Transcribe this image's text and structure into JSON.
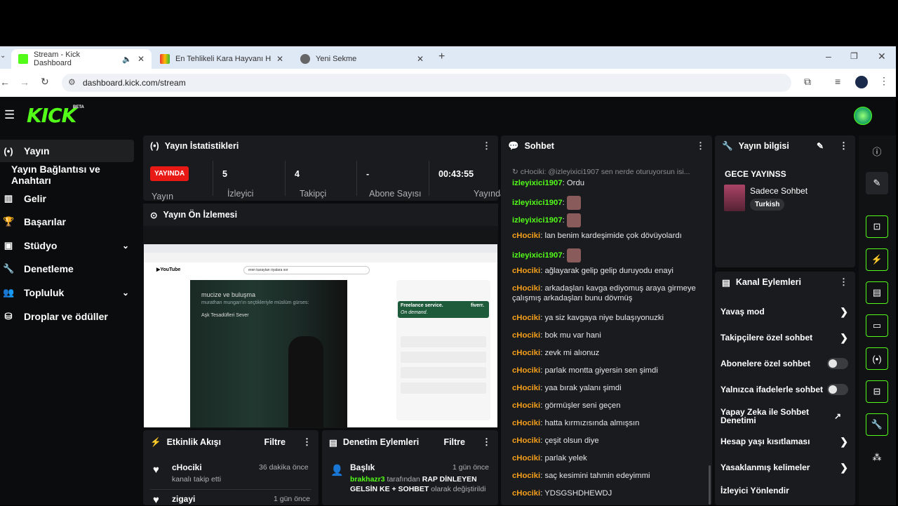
{
  "browser": {
    "tabs": [
      {
        "title": "Stream - Kick Dashboard",
        "active": true
      },
      {
        "title": "En Tehlikeli Kara Hayvanı Hangi",
        "active": false
      },
      {
        "title": "Yeni Sekme",
        "active": false
      }
    ],
    "url": "dashboard.kick.com/stream"
  },
  "app": {
    "logo": "KICK",
    "logo_badge": "BETA",
    "nav": [
      {
        "label": "Yayın",
        "icon": "broadcast-icon",
        "active": true
      },
      {
        "label": "Yayın Bağlantısı ve Anahtarı",
        "icon": "",
        "active": false
      },
      {
        "label": "Gelir",
        "icon": "revenue-icon",
        "active": false
      },
      {
        "label": "Başarılar",
        "icon": "trophy-icon",
        "active": false
      },
      {
        "label": "Stüdyo",
        "icon": "studio-icon",
        "active": false,
        "expandable": true
      },
      {
        "label": "Denetleme",
        "icon": "wrench-icon",
        "active": false
      },
      {
        "label": "Topluluk",
        "icon": "community-icon",
        "active": false,
        "expandable": true
      },
      {
        "label": "Droplar ve ödüller",
        "icon": "drops-icon",
        "active": false
      }
    ]
  },
  "stats": {
    "title": "Yayın İstatistikleri",
    "live_badge": "YAYINDA",
    "items": [
      {
        "label": "Yayın",
        "value": ""
      },
      {
        "label": "İzleyici",
        "value": "5"
      },
      {
        "label": "Takipçi",
        "value": "4"
      },
      {
        "label": "Abone Sayısı",
        "value": "-"
      },
      {
        "label": "Yayında",
        "value": "00:43:55"
      }
    ]
  },
  "preview": {
    "title": "Yayın Ön İzlemesi",
    "video_title_1": "mucize ve buluşma",
    "video_title_2": "murathan mungan'ın seçtikleriyle müslüm gürses:",
    "video_title_3": "Aşk Tesadüfleri Sever",
    "search_text": "eren karaytan riyalara sor",
    "ad_title": "Freelance service.",
    "ad_sub": "On demand.",
    "ad_brand": "fiverr."
  },
  "activity": {
    "title": "Etkinlik Akışı",
    "filter": "Filtre",
    "items": [
      {
        "user": "cHociki",
        "time": "36 dakika önce",
        "text": "kanalı takip etti"
      },
      {
        "user": "zigayi",
        "time": "1 gün önce",
        "text": ""
      }
    ]
  },
  "moderation": {
    "title": "Denetim Eylemleri",
    "filter": "Filtre",
    "items": [
      {
        "heading": "Başlık",
        "time": "1 gün önce",
        "actor": "brakhazr3",
        "text1": " tarafından ",
        "value": "RAP DİNLEYEN GELSİN KE + SOHBET",
        "text2": " olarak değiştirildi"
      }
    ]
  },
  "chat": {
    "title": "Sohbet",
    "reply": "↻ cHociki: @izleyixici1907 sen nerde oturuyorsun isi...",
    "messages": [
      {
        "user": "izleyixici1907",
        "text": "Ordu",
        "emote": false,
        "color": "green"
      },
      {
        "user": "izleyixici1907",
        "text": "",
        "emote": true,
        "color": "green"
      },
      {
        "user": "izleyixici1907",
        "text": "",
        "emote": true,
        "color": "green"
      },
      {
        "user": "cHociki",
        "text": "lan benim kardeşimide çok dövüyolardı",
        "emote": false,
        "color": "orange"
      },
      {
        "user": "izleyixici1907",
        "text": "",
        "emote": true,
        "color": "green"
      },
      {
        "user": "cHociki",
        "text": "ağlayarak gelip gelip duruyodu enayi",
        "emote": false,
        "color": "orange"
      },
      {
        "user": "cHociki",
        "text": "arkadaşları kavga ediyomuş araya girmeye çalışmış arkadaşları bunu dövmüş",
        "emote": false,
        "color": "orange"
      },
      {
        "user": "cHociki",
        "text": "ya siz kavgaya niye bulaşıyonuzki",
        "emote": false,
        "color": "orange"
      },
      {
        "user": "cHociki",
        "text": "bok mu var hani",
        "emote": false,
        "color": "orange"
      },
      {
        "user": "cHociki",
        "text": "zevk mi alıonuz",
        "emote": false,
        "color": "orange"
      },
      {
        "user": "cHociki",
        "text": "parlak montta giyersin sen şimdi",
        "emote": false,
        "color": "orange"
      },
      {
        "user": "cHociki",
        "text": "yaa bırak yalanı şimdi",
        "emote": false,
        "color": "orange"
      },
      {
        "user": "cHociki",
        "text": "görmüşler seni geçen",
        "emote": false,
        "color": "orange"
      },
      {
        "user": "cHociki",
        "text": "hatta kırmızısında almışsın",
        "emote": false,
        "color": "orange"
      },
      {
        "user": "cHociki",
        "text": "çeşit olsun diye",
        "emote": false,
        "color": "orange"
      },
      {
        "user": "cHociki",
        "text": "parlak yelek",
        "emote": false,
        "color": "orange"
      },
      {
        "user": "cHociki",
        "text": "saç kesimini tahmin edeyimmi",
        "emote": false,
        "color": "orange"
      },
      {
        "user": "cHociki",
        "text": "YDSGSHDHEWDJ",
        "emote": false,
        "color": "orange"
      }
    ]
  },
  "stream_info": {
    "title": "Yayın bilgisi",
    "stream_title": "GECE YAYINSS",
    "category": "Sadece Sohbet",
    "tag": "Turkish"
  },
  "channel_actions": {
    "title": "Kanal Eylemleri",
    "items": [
      {
        "label": "Yavaş mod",
        "control": "arrow"
      },
      {
        "label": "Takipçilere özel sohbet",
        "control": "arrow"
      },
      {
        "label": "Abonelere özel sohbet",
        "control": "toggle"
      },
      {
        "label": "Yalnızca ifadelerle sohbet",
        "control": "toggle"
      },
      {
        "label": "Yapay Zeka ile Sohbet Denetimi",
        "control": "external"
      },
      {
        "label": "Hesap yaşı kısıtlaması",
        "control": "arrow"
      },
      {
        "label": "Yasaklanmış kelimeler",
        "control": "arrow"
      },
      {
        "label": "İzleyici Yönlendir",
        "control": "none"
      }
    ]
  },
  "colors": {
    "brand": "#53fc18",
    "live": "#e91916",
    "chat_user_orange": "#f7a01b"
  }
}
